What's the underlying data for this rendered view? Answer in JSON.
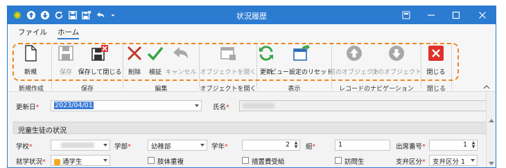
{
  "window": {
    "title": "状況履歴",
    "accent_color": "#2b7bd0",
    "quick_access": [
      "app-icon",
      "up-arrow-icon",
      "down-arrow-icon",
      "refresh-icon",
      "save-icon",
      "save-close-icon",
      "undo-icon",
      "dropdown-icon"
    ],
    "controls": [
      "ribbon-display-icon",
      "minimize-icon",
      "maximize-icon",
      "close-icon"
    ]
  },
  "tabs": [
    {
      "label": "ファイル",
      "active": false
    },
    {
      "label": "ホーム",
      "active": true
    }
  ],
  "ribbon": {
    "buttons": {
      "new": "新規",
      "save": "保存",
      "save_close": "保存して閉じる",
      "delete": "削除",
      "verify": "検証",
      "cancel": "キャンセル",
      "open_object": "オブジェクトを開く",
      "refresh": "更新",
      "reset_view": "ビュー設定のリセット",
      "prev_object": "前のオブジェクト",
      "next_object": "次のオブジェクト",
      "close": "閉じる"
    },
    "groups": {
      "create": "新規作成",
      "save": "保存",
      "edit": "編集",
      "open_object": "オブジェクトを開く",
      "display": "表示",
      "record_nav": "レコードのナビゲーション",
      "close": "閉じる"
    },
    "highlight_color": "#f0851d"
  },
  "form": {
    "update_date_label": "更新日",
    "update_date_value": "2023/04/01",
    "name_label": "氏名",
    "section_title": "児童生徒の状況",
    "school_label": "学校",
    "faculty_label": "学部",
    "faculty_value": "幼稚部",
    "grade_label": "学年",
    "grade_value": "2",
    "class_label": "組",
    "class_value": "1",
    "attendance_no_label": "出席番号",
    "attendance_no_value": "1",
    "enrollment_label": "就学状況",
    "enrollment_value": "通学生",
    "multiple_disability_label": "肢体重複",
    "support_measure_label": "措置費受給",
    "home_visit_label": "訪問生",
    "support_category_label": "支弁区分",
    "support_category_value": "支弁区分 1"
  }
}
